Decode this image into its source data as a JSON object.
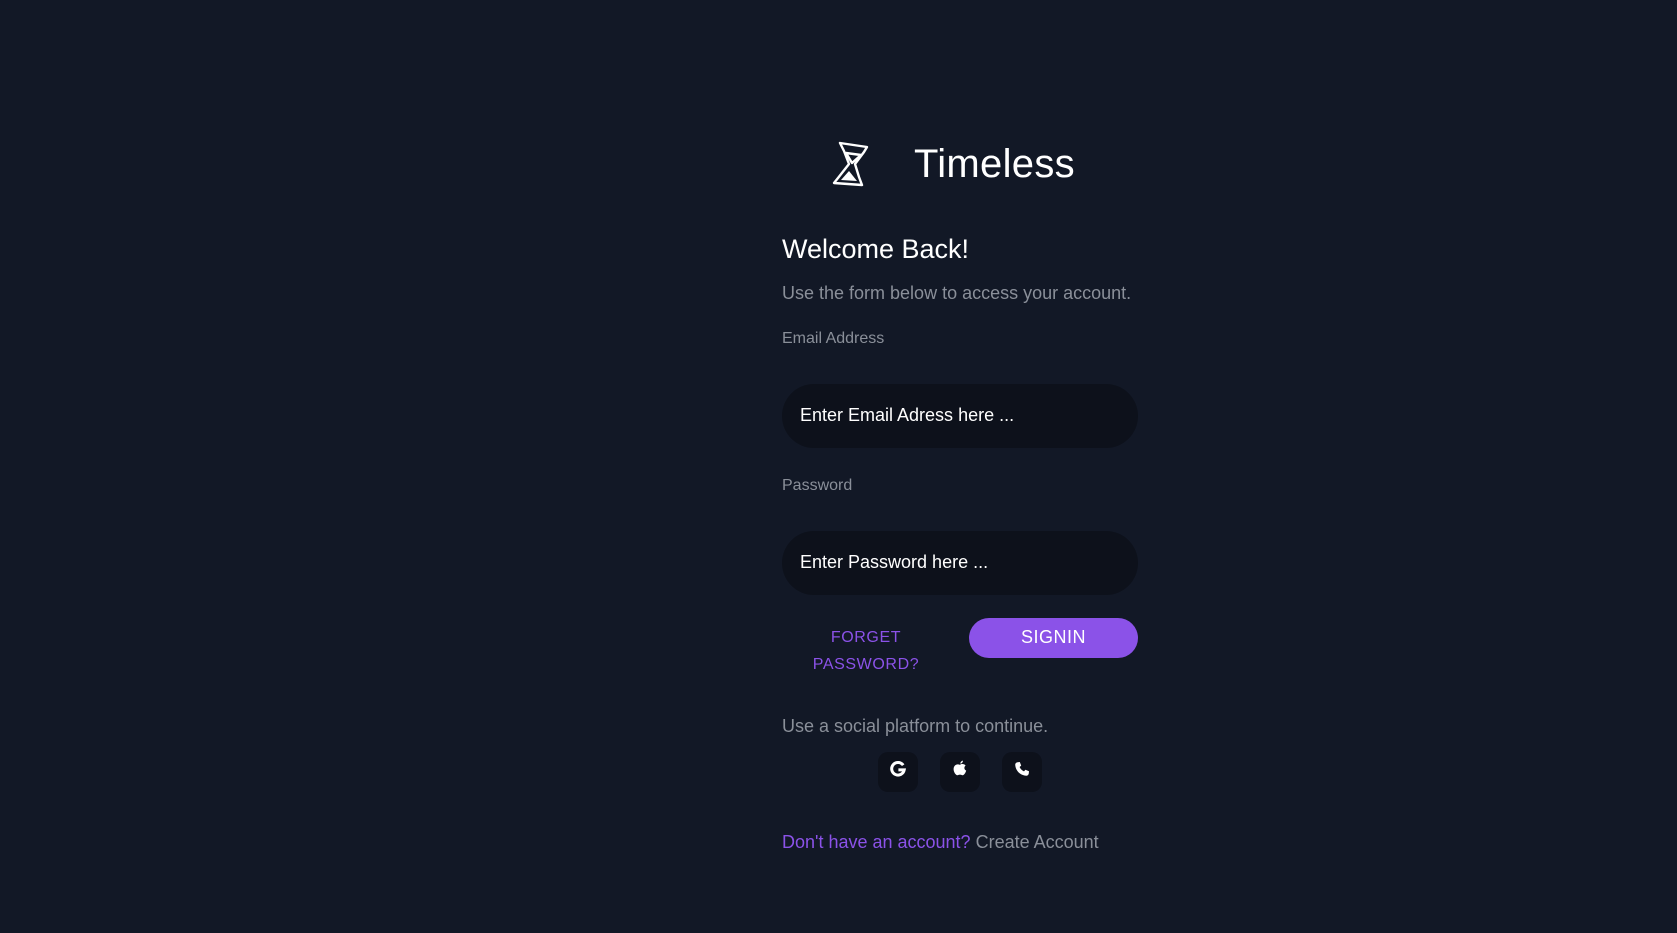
{
  "brand": {
    "name": "Timeless",
    "logo_icon": "hourglass-icon"
  },
  "login": {
    "title": "Welcome Back!",
    "subtitle": "Use the form below to access your account.",
    "email": {
      "label": "Email Address",
      "value": "",
      "placeholder": "Enter Email Adress here ..."
    },
    "password": {
      "label": "Password",
      "value": "",
      "placeholder": "Enter Password here ..."
    },
    "forgot_password_label": "FORGET PASSWORD?",
    "signin_label": "SIGNIN",
    "social_prompt": "Use a social platform to continue.",
    "social_buttons": [
      {
        "icon": "google-icon"
      },
      {
        "icon": "apple-icon"
      },
      {
        "icon": "phone-icon"
      }
    ],
    "footer": {
      "prompt": "Don't have an account?",
      "link": "Create Account"
    }
  },
  "colors": {
    "background": "#121826",
    "input_background": "#0d111b",
    "accent": "#8b52e8",
    "muted_text": "#8a8f99",
    "text": "#ffffff"
  }
}
